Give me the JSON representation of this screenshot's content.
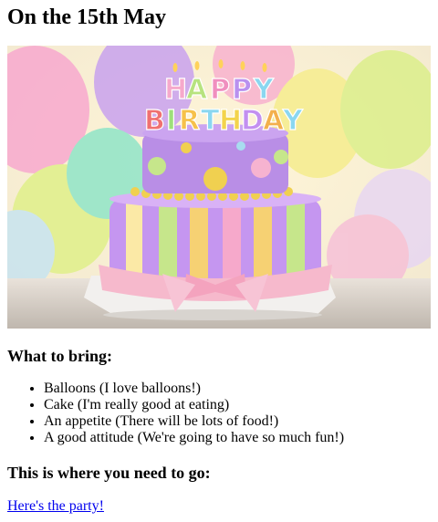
{
  "heading": "On the 15th May",
  "image": {
    "cake_text_top": "HAPPY",
    "cake_text_bottom": "BIRTHDAY"
  },
  "bring": {
    "heading": "What to bring:",
    "items": [
      "Balloons (I love balloons!)",
      "Cake (I'm really good at eating)",
      "An appetite (There will be lots of food!)",
      "A good attitude (We're going to have so much fun!)"
    ]
  },
  "go": {
    "heading": "This is where you need to go:"
  },
  "link": {
    "label": "Here's the party!"
  },
  "colors": {
    "link": "#0000ee"
  }
}
